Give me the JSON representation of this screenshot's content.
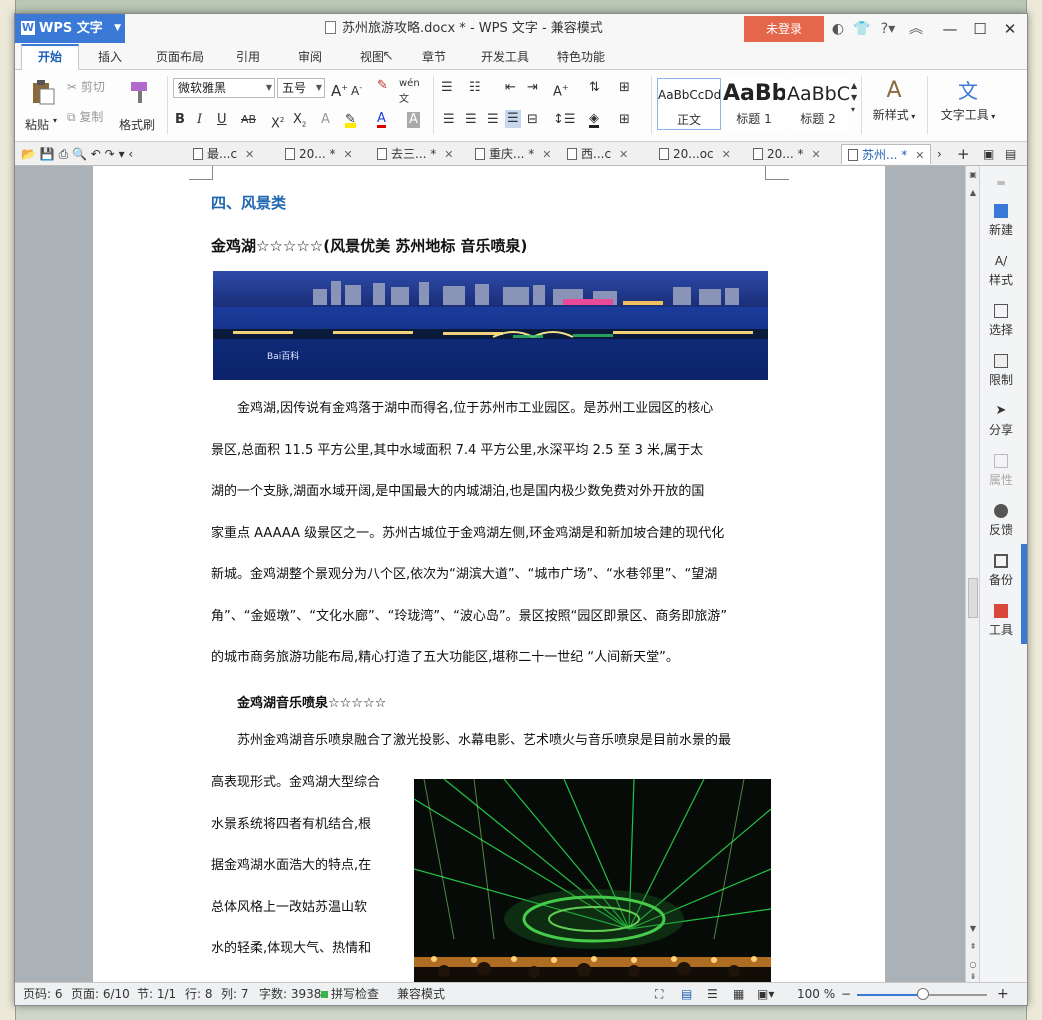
{
  "window": {
    "app_name": "WPS 文字",
    "title": "苏州旅游攻略.docx * - WPS 文字 - 兼容模式",
    "login_label": "未登录"
  },
  "ribbon_tabs": [
    "开始",
    "插入",
    "页面布局",
    "引用",
    "审阅",
    "视图",
    "章节",
    "开发工具",
    "特色功能"
  ],
  "ribbon": {
    "paste": "粘贴",
    "cut": "剪切",
    "copy": "复制",
    "format_painter": "格式刷",
    "font_name": "微软雅黑",
    "font_size": "五号",
    "styles": [
      {
        "sample": "AaBbCcDd",
        "name": "正文"
      },
      {
        "sample": "AaBb",
        "name": "标题 1"
      },
      {
        "sample": "AaBbC",
        "name": "标题 2"
      }
    ],
    "new_style": "新样式",
    "text_tools": "文字工具"
  },
  "doc_tabs": [
    {
      "label": "最...c",
      "active": false
    },
    {
      "label": "20... *",
      "active": false
    },
    {
      "label": "去三... *",
      "active": false
    },
    {
      "label": "重庆... *",
      "active": false
    },
    {
      "label": "西...c",
      "active": false
    },
    {
      "label": "20...oc",
      "active": false
    },
    {
      "label": "20... *",
      "active": false
    },
    {
      "label": "苏州... *",
      "active": true
    }
  ],
  "document": {
    "section_heading": "四、风景类",
    "attraction_title": "金鸡湖☆☆☆☆☆(风景优美 苏州地标 音乐喷泉)",
    "para1_lines": [
      "金鸡湖,因传说有金鸡落于湖中而得名,位于苏州市工业园区。是苏州工业园区的核心",
      "景区,总面积 11.5 平方公里,其中水域面积 7.4 平方公里,水深平均 2.5 至 3 米,属于太",
      "湖的一个支脉,湖面水域开阔,是中国最大的内城湖泊,也是国内极少数免费对外开放的国",
      "家重点 AAAAA 级景区之一。苏州古城位于金鸡湖左侧,环金鸡湖是和新加坡合建的现代化",
      "新城。金鸡湖整个景观分为八个区,依次为“湖滨大道”、“城市广场”、“水巷邻里”、“望湖",
      "角”、“金姬墩”、“文化水廊”、“玲珑湾”、“波心岛”。景区按照“园区即景区、商务即旅游”",
      "的城市商务旅游功能布局,精心打造了五大功能区,堪称二十一世纪 “人间新天堂”。"
    ],
    "fountain_heading": "金鸡湖音乐喷泉☆☆☆☆☆",
    "para2_first": "苏州金鸡湖音乐喷泉融合了激光投影、水幕电影、艺术喷火与音乐喷泉是目前水景的最",
    "para2_wrapped": [
      "高表现形式。金鸡湖大型综合",
      "水景系统将四者有机结合,根",
      "据金鸡湖水面浩大的特点,在",
      "总体风格上一改姑苏温山软",
      "水的轻柔,体现大气、热情和"
    ],
    "image_watermark": "Bai百科"
  },
  "taskpane": [
    {
      "label": "新建",
      "icon": "new-doc-icon",
      "disabled": false
    },
    {
      "label": "样式",
      "icon": "style-icon",
      "disabled": false
    },
    {
      "label": "选择",
      "icon": "select-icon",
      "disabled": false
    },
    {
      "label": "限制",
      "icon": "restrict-icon",
      "disabled": false
    },
    {
      "label": "分享",
      "icon": "share-icon",
      "disabled": false
    },
    {
      "label": "属性",
      "icon": "properties-icon",
      "disabled": true
    },
    {
      "label": "反馈",
      "icon": "feedback-icon",
      "disabled": false
    },
    {
      "label": "备份",
      "icon": "backup-icon",
      "disabled": false
    },
    {
      "label": "工具",
      "icon": "toolbox-icon",
      "disabled": false
    }
  ],
  "status": {
    "page": "页码: 6",
    "pages": "页面: 6/10",
    "section": "节: 1/1",
    "row": "行: 8",
    "col": "列: 7",
    "words": "字数: 3938",
    "spell": "拼写检查",
    "mode": "兼容模式",
    "zoom": "100 %"
  },
  "colors": {
    "accent": "#3a7ad6",
    "heading_blue": "#1f67b1",
    "login_red": "#e4664b"
  }
}
